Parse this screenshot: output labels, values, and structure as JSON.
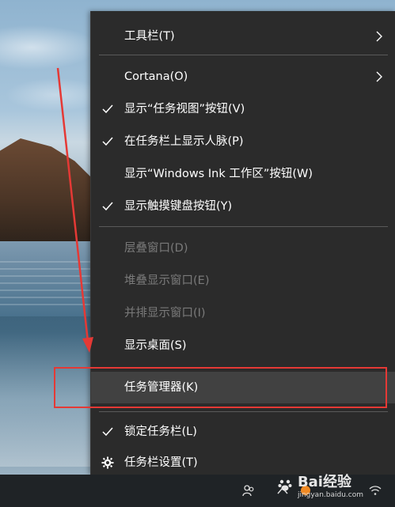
{
  "menu": {
    "items": [
      {
        "label": "工具栏(T)",
        "checked": false,
        "submenu": true,
        "disabled": false
      },
      {
        "label": "Cortana(O)",
        "checked": false,
        "submenu": true,
        "disabled": false
      },
      {
        "label": "显示“任务视图”按钮(V)",
        "checked": true,
        "submenu": false,
        "disabled": false
      },
      {
        "label": "在任务栏上显示人脉(P)",
        "checked": true,
        "submenu": false,
        "disabled": false
      },
      {
        "label": "显示“Windows Ink 工作区”按钮(W)",
        "checked": false,
        "submenu": false,
        "disabled": false
      },
      {
        "label": "显示触摸键盘按钮(Y)",
        "checked": true,
        "submenu": false,
        "disabled": false
      },
      {
        "label": "层叠窗口(D)",
        "checked": false,
        "submenu": false,
        "disabled": true
      },
      {
        "label": "堆叠显示窗口(E)",
        "checked": false,
        "submenu": false,
        "disabled": true
      },
      {
        "label": "并排显示窗口(I)",
        "checked": false,
        "submenu": false,
        "disabled": true
      },
      {
        "label": "显示桌面(S)",
        "checked": false,
        "submenu": false,
        "disabled": false
      },
      {
        "label": "任务管理器(K)",
        "checked": false,
        "submenu": false,
        "disabled": false,
        "highlighted": true
      },
      {
        "label": "锁定任务栏(L)",
        "checked": true,
        "submenu": false,
        "disabled": false
      },
      {
        "label": "任务栏设置(T)",
        "checked": false,
        "submenu": false,
        "disabled": false,
        "icon": "gear-icon"
      }
    ]
  },
  "taskbar": {
    "tray_icons": [
      "people-icon",
      "chevron-up-icon",
      "network-icon"
    ]
  },
  "watermark": {
    "text": "Bai经验",
    "url": "jingyan.baidu.com"
  },
  "colors": {
    "menu_bg": "#2b2b2b",
    "menu_text": "#ffffff",
    "disabled_text": "#7a7a7a",
    "hover_bg": "#414141",
    "annotation": "#e53935"
  }
}
